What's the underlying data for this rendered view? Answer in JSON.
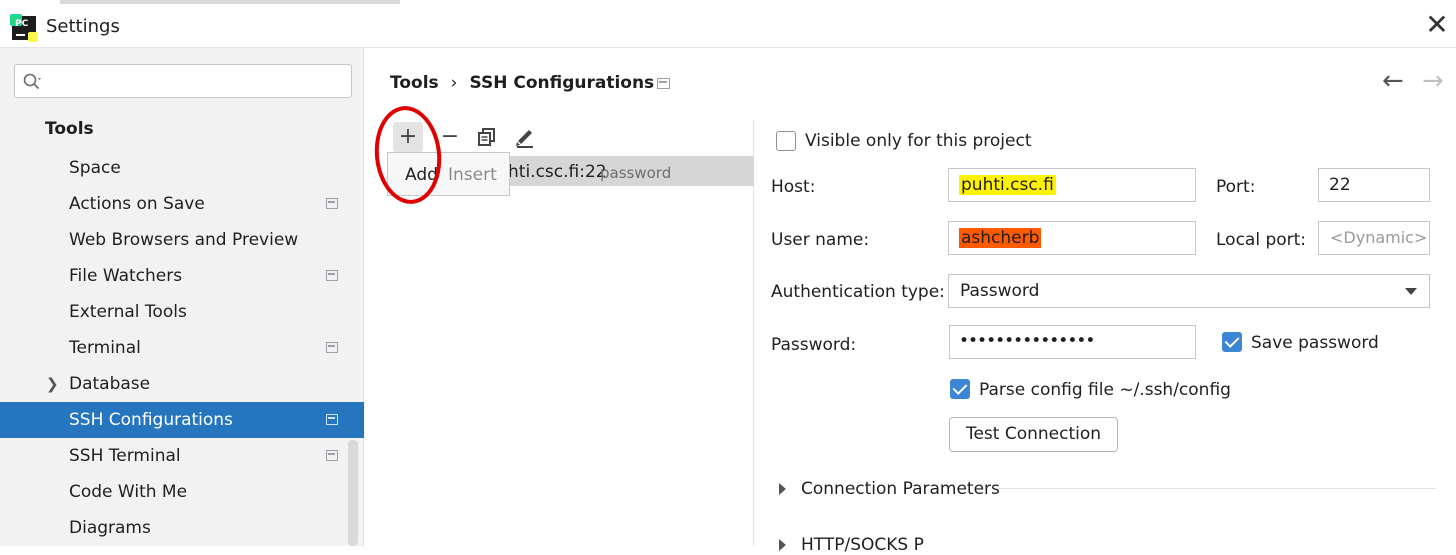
{
  "window": {
    "title": "Settings",
    "close_glyph": "✕",
    "app_icon_text": "PC"
  },
  "sidebar": {
    "search_placeholder": "",
    "heading": "Tools",
    "items": [
      {
        "label": "Space",
        "project_icon": false
      },
      {
        "label": "Actions on Save",
        "project_icon": true
      },
      {
        "label": "Web Browsers and Preview",
        "project_icon": false
      },
      {
        "label": "File Watchers",
        "project_icon": true
      },
      {
        "label": "External Tools",
        "project_icon": false
      },
      {
        "label": "Terminal",
        "project_icon": true
      },
      {
        "label": "Database",
        "project_icon": false,
        "expandable": true
      },
      {
        "label": "SSH Configurations",
        "project_icon": true,
        "selected": true
      },
      {
        "label": "SSH Terminal",
        "project_icon": true
      },
      {
        "label": "Code With Me",
        "project_icon": false
      },
      {
        "label": "Diagrams",
        "project_icon": false
      }
    ]
  },
  "breadcrumb": {
    "parent": "Tools",
    "separator": "›",
    "current": "SSH Configurations"
  },
  "nav": {
    "back": "←",
    "forward": "→"
  },
  "list_toolbar": {
    "add": "+",
    "remove": "−",
    "copy": "⧉",
    "edit": "✎"
  },
  "tooltip": {
    "action": "Add",
    "shortcut": "Insert"
  },
  "config_list": [
    {
      "host": "hti.csc.fi:22",
      "auth": "password"
    }
  ],
  "form": {
    "visible_only_label": "Visible only for this project",
    "visible_only_checked": false,
    "host_label": "Host:",
    "host_value": "puhti.csc.fi",
    "port_label": "Port:",
    "port_value": "22",
    "username_label": "User name:",
    "username_value": "ashcherb",
    "local_port_label": "Local port:",
    "local_port_placeholder": "<Dynamic>",
    "auth_type_label": "Authentication type:",
    "auth_type_value": "Password",
    "password_label": "Password:",
    "password_value": "•••••••••••••••",
    "save_password_label": "Save password",
    "save_password_checked": true,
    "parse_config_label": "Parse config file ~/.ssh/config",
    "parse_config_checked": true,
    "test_button": "Test Connection"
  },
  "sections": {
    "connection_parameters": "Connection Parameters",
    "http_socks": "HTTP/SOCKS P"
  },
  "colors": {
    "selection": "#2675bf",
    "highlight_yellow": "#fff200",
    "highlight_orange": "#ff5a00",
    "annotation_red": "#e00000"
  }
}
